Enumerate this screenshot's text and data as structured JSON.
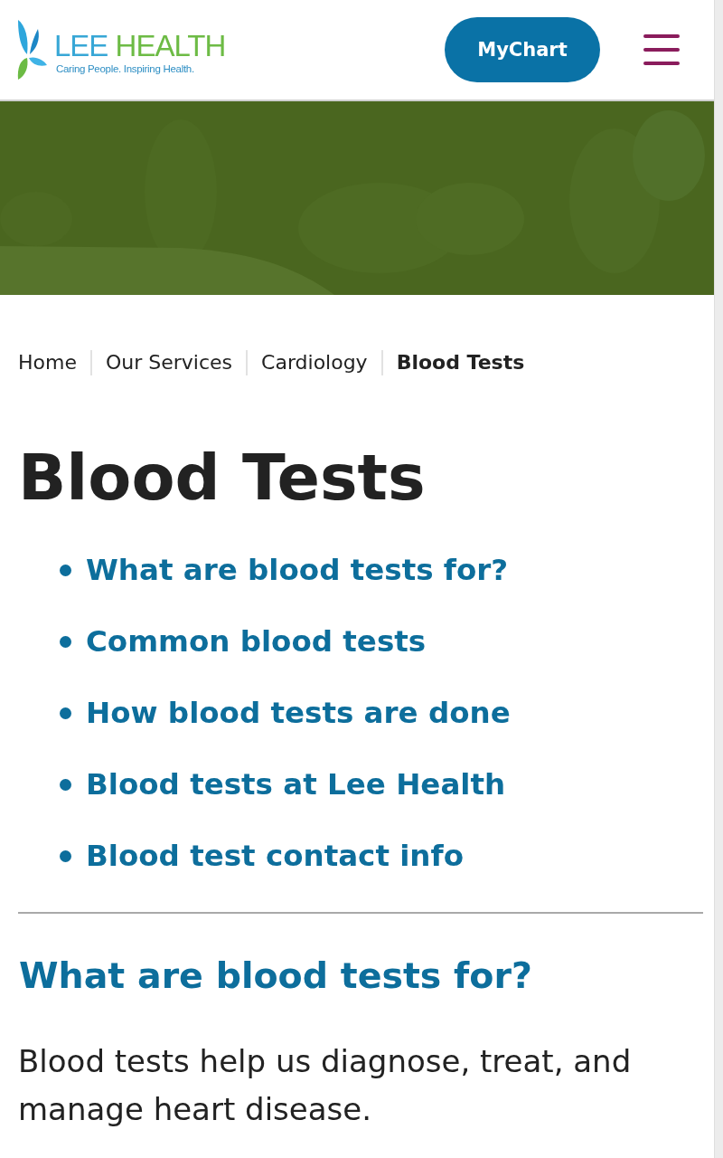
{
  "header": {
    "logo": {
      "name_first": "LEE",
      "name_second": "HEALTH",
      "tagline": "Caring People. Inspiring Health."
    },
    "button": "MyChart"
  },
  "breadcrumbs": [
    {
      "label": "Home",
      "current": false
    },
    {
      "label": "Our Services",
      "current": false
    },
    {
      "label": "Cardiology",
      "current": false
    },
    {
      "label": "Blood Tests",
      "current": true
    }
  ],
  "page_title": "Blood Tests",
  "contents": [
    "What are blood tests for?",
    "Common blood tests",
    "How blood tests are done",
    "Blood tests at Lee Health",
    "Blood test contact info"
  ],
  "section": {
    "heading": "What are blood tests for?",
    "paragraph": "Blood tests help us diagnose, treat, and manage heart disease."
  }
}
